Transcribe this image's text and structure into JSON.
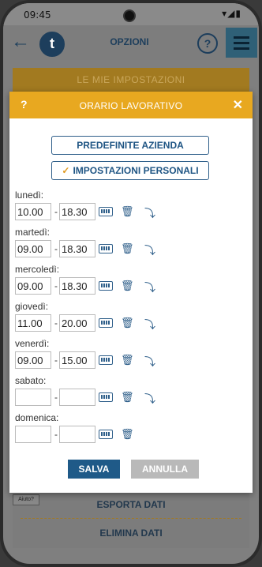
{
  "status": {
    "time": "09:45",
    "icons": "▾◢▮"
  },
  "appbar": {
    "back_icon": "←",
    "logo_letter": "t",
    "title": "OPZIONI",
    "help": "?"
  },
  "background": {
    "section_title": "LE MIE IMPOSTAZIONI",
    "help_tag": "Aiuto?",
    "export": "ESPORTA DATI",
    "delete": "ELIMINA DATI"
  },
  "dialog": {
    "help": "?",
    "title": "ORARIO LAVORATIVO",
    "close": "✕",
    "option1": "PREDEFINITE AZIENDA",
    "option2": "IMPOSTAZIONI PERSONALI",
    "check": "✓",
    "dash": "-",
    "days": [
      {
        "label": "lunedì:",
        "start": "10.00",
        "end": "18.30",
        "copy": true
      },
      {
        "label": "martedì:",
        "start": "09.00",
        "end": "18.30",
        "copy": true
      },
      {
        "label": "mercoledì:",
        "start": "09.00",
        "end": "18.30",
        "copy": true
      },
      {
        "label": "giovedì:",
        "start": "11.00",
        "end": "20.00",
        "copy": true
      },
      {
        "label": "venerdì:",
        "start": "09.00",
        "end": "15.00",
        "copy": true
      },
      {
        "label": "sabato:",
        "start": "",
        "end": "",
        "copy": true
      },
      {
        "label": "domenica:",
        "start": "",
        "end": "",
        "copy": false
      }
    ],
    "save": "SALVA",
    "cancel": "ANNULLA"
  },
  "icons": {
    "keyboard": "keyboard-icon",
    "trash": "trash-icon",
    "copy": "copy-down-icon"
  },
  "colors": {
    "accent": "#e8a820",
    "primary": "#1f5a88"
  }
}
